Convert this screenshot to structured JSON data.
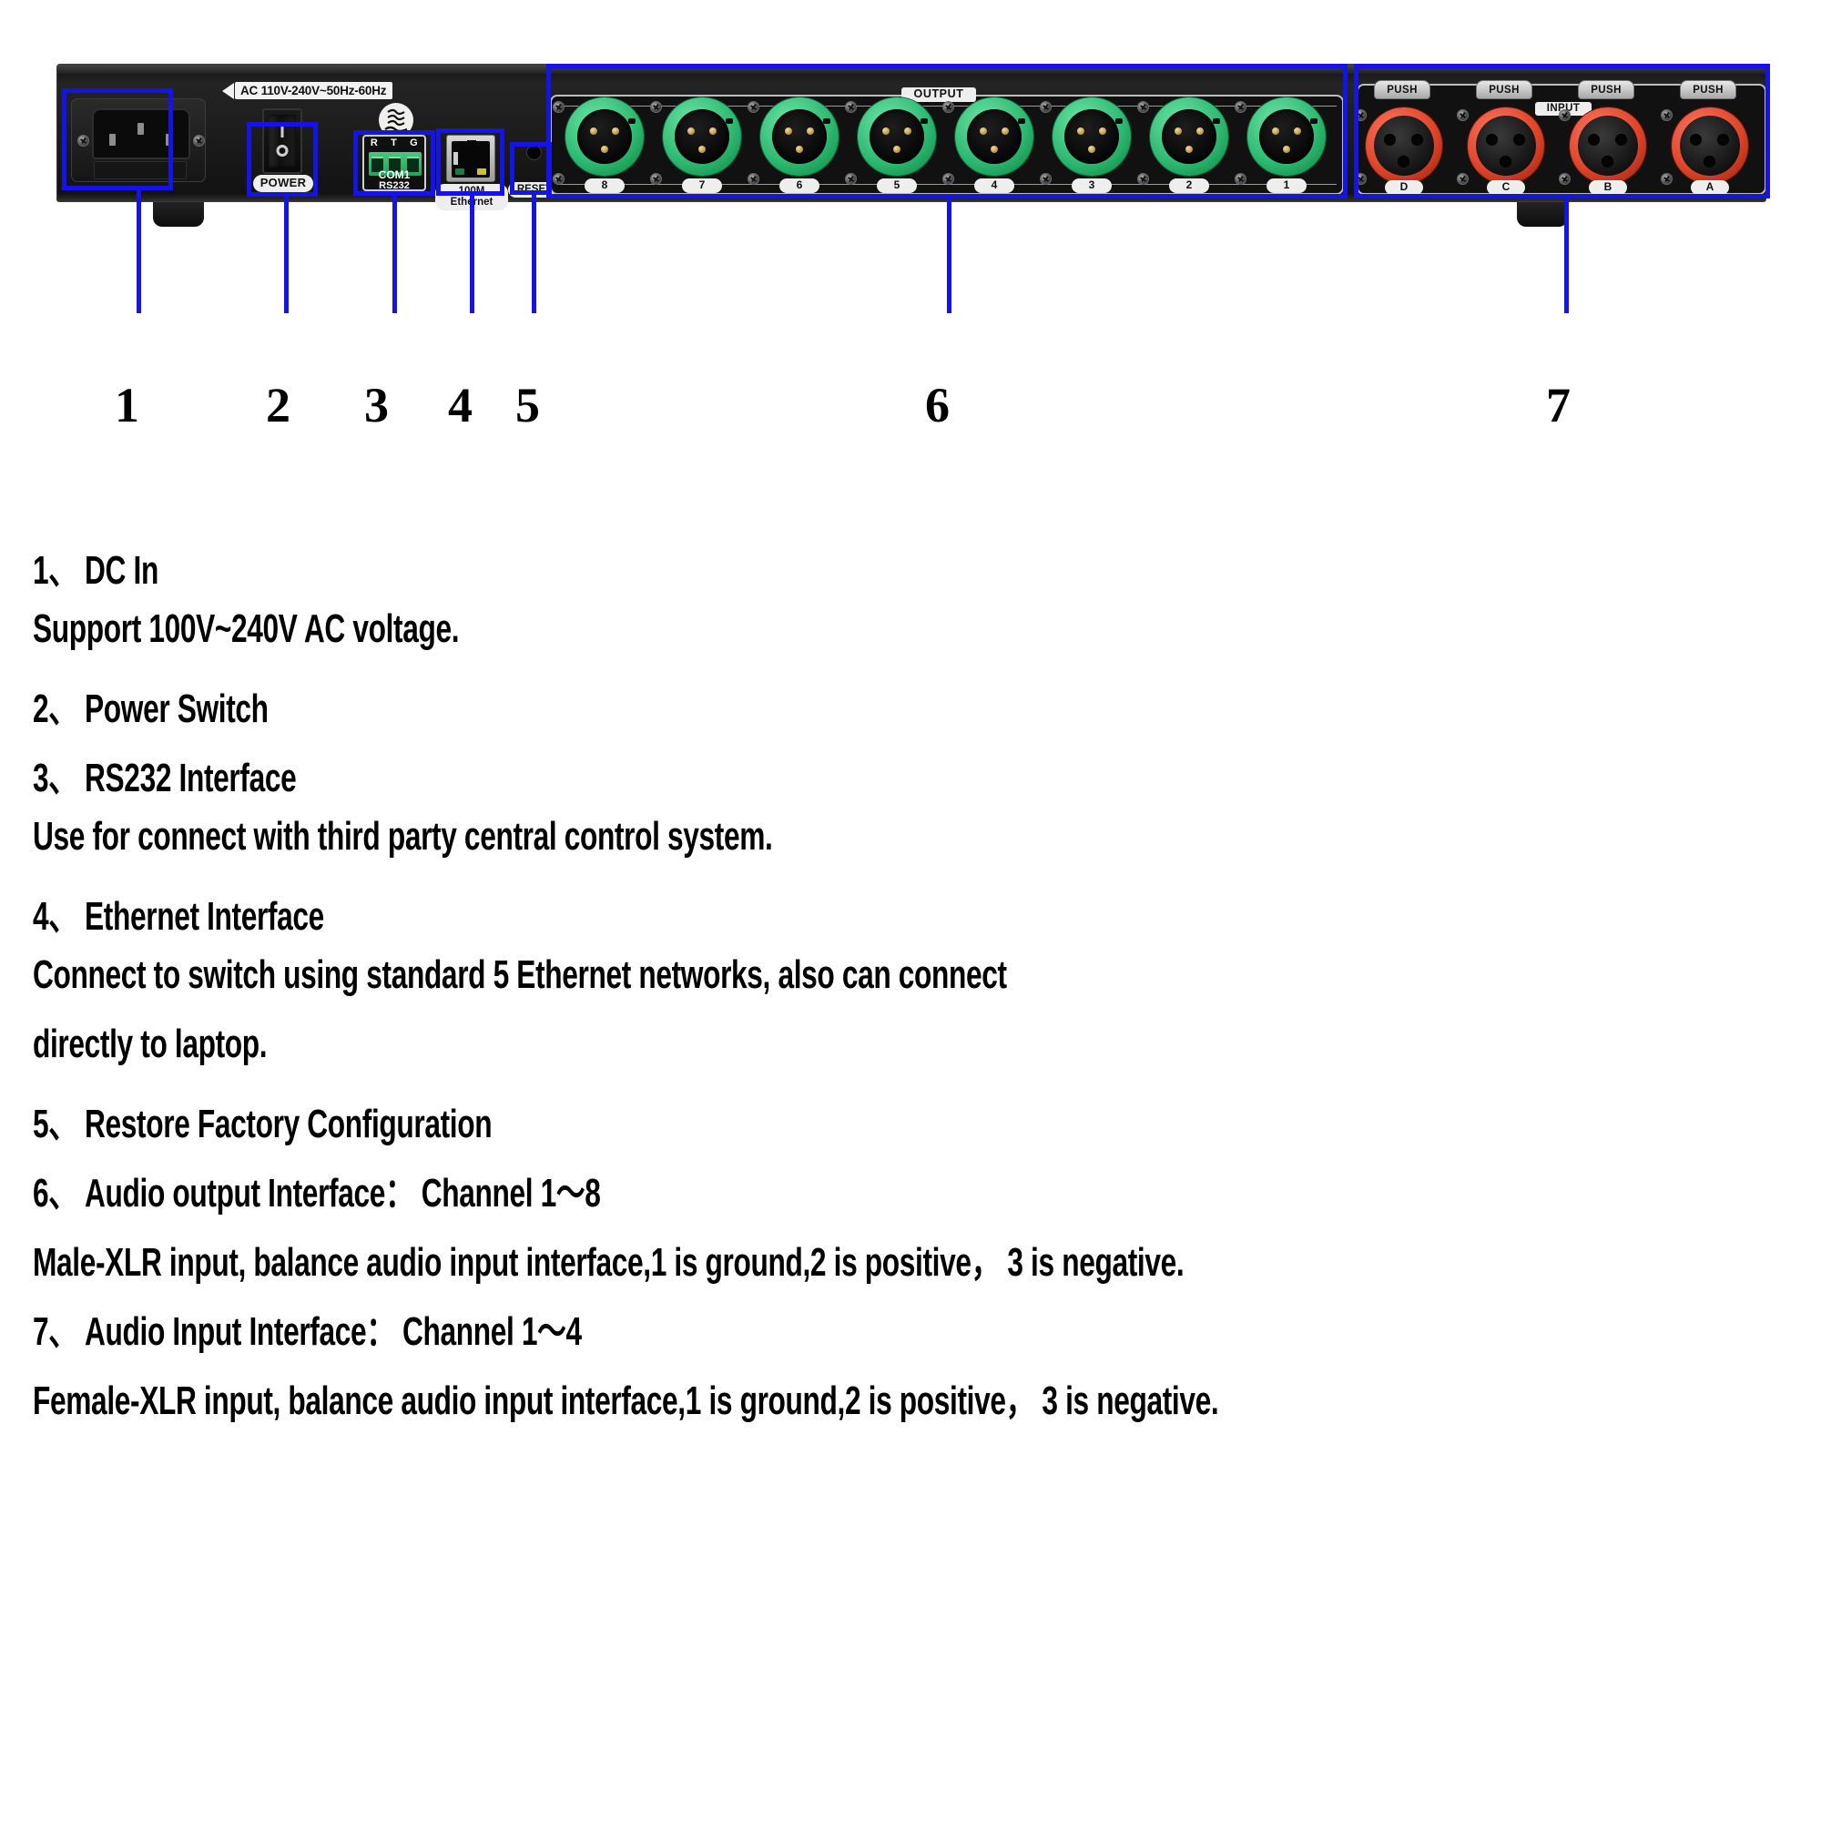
{
  "device": {
    "ac_label": "AC 110V-240V~50Hz-60Hz",
    "power_label": "POWER",
    "ccc_mark": "CCC",
    "rs232": {
      "terminals": [
        "R",
        "T",
        "G"
      ],
      "line1": "COM1",
      "line2": "RS232"
    },
    "ethernet_label_line1": "100M",
    "ethernet_label_line2": "Ethernet",
    "reset_label": "RESET",
    "output_section_label": "OUTPUT",
    "output_channels": [
      "8",
      "7",
      "6",
      "5",
      "4",
      "3",
      "2",
      "1"
    ],
    "input_section_label": "INPUT",
    "input_push_label": "PUSH",
    "input_channels": [
      "D",
      "C",
      "B",
      "A"
    ]
  },
  "callouts": [
    {
      "number": "1",
      "target": "dc-in"
    },
    {
      "number": "2",
      "target": "power-switch"
    },
    {
      "number": "3",
      "target": "rs232-interface"
    },
    {
      "number": "4",
      "target": "ethernet-interface"
    },
    {
      "number": "5",
      "target": "reset-button"
    },
    {
      "number": "6",
      "target": "audio-output-interface"
    },
    {
      "number": "7",
      "target": "audio-input-interface"
    }
  ],
  "descriptions": [
    {
      "id": "item-1-title",
      "text": "1、 DC In",
      "type": "title"
    },
    {
      "id": "item-1-body",
      "text": "Support 100V~240V AC voltage.",
      "type": "body"
    },
    {
      "id": "item-2-title",
      "text": "2、 Power Switch",
      "type": "title"
    },
    {
      "id": "item-3-title",
      "text": "3、 RS232 Interface",
      "type": "title"
    },
    {
      "id": "item-3-body",
      "text": "Use for connect with third party central control system.",
      "type": "body"
    },
    {
      "id": "item-4-title",
      "text": "4、 Ethernet Interface",
      "type": "title"
    },
    {
      "id": "item-4-body-1",
      "text": "Connect to switch using standard 5 Ethernet networks, also can connect",
      "type": "body"
    },
    {
      "id": "item-4-body-2",
      "text": "directly to laptop.",
      "type": "body"
    },
    {
      "id": "item-5-title",
      "text": "5、 Restore Factory Configuration",
      "type": "title"
    },
    {
      "id": "item-6-title",
      "text": "6、 Audio output Interface： Channel 1～8",
      "type": "title"
    },
    {
      "id": "item-6-body",
      "text": "Male-XLR input, balance audio input interface,1 is ground,2 is positive， 3 is negative.",
      "type": "body"
    },
    {
      "id": "item-7-title",
      "text": "7、 Audio Input Interface： Channel 1～4",
      "type": "title"
    },
    {
      "id": "item-7-body",
      "text": "Female-XLR input, balance audio input interface,1 is ground,2 is positive， 3 is negative.",
      "type": "body"
    }
  ],
  "colors": {
    "callout_blue": "#1414e6",
    "output_connector_green": "#2fba72",
    "input_connector_red": "#e0452b",
    "chassis_black": "#1a1a1a",
    "label_white": "#eeeeee"
  }
}
